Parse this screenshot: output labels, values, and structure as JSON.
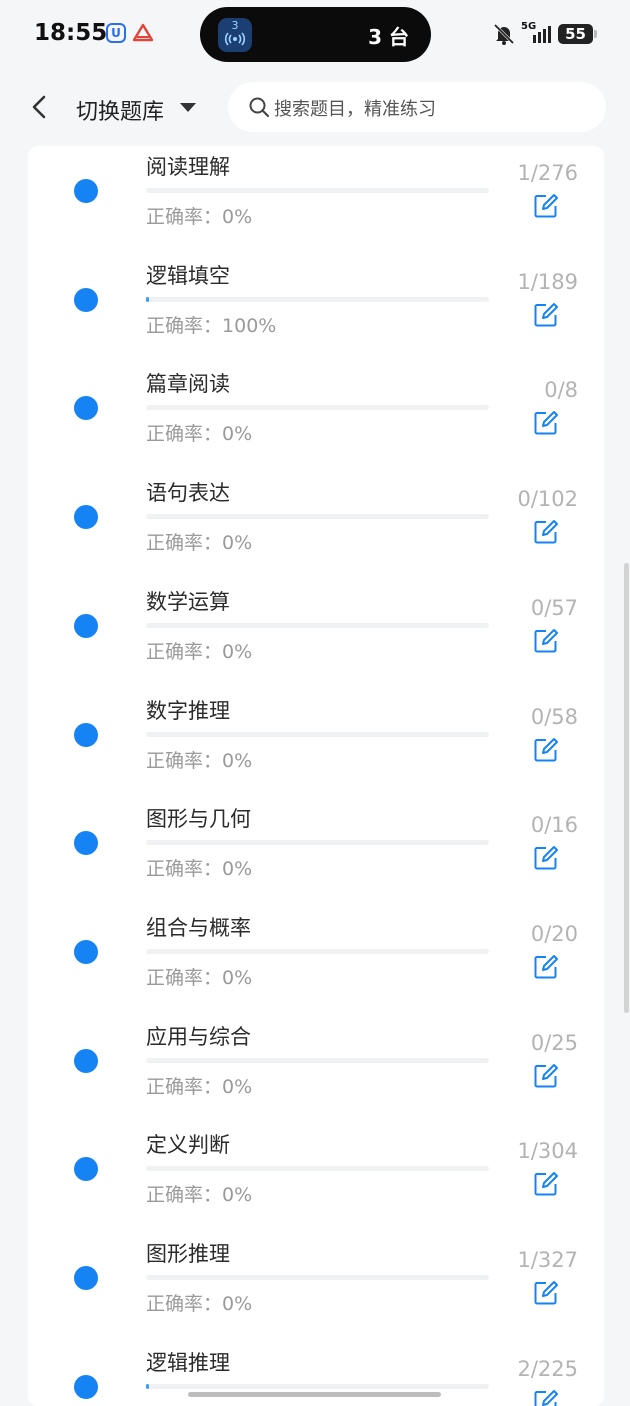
{
  "status_bar": {
    "time": "18:55",
    "island_text": "3 台",
    "island_badge": "3",
    "network": "5G",
    "battery": "55"
  },
  "header": {
    "title": "切换题库",
    "search_placeholder": "搜索题目，精准练习"
  },
  "colors": {
    "accent": "#1683f4",
    "progress": "#3aa0f5"
  },
  "list": {
    "accuracy_label": "正确率：",
    "items": [
      {
        "title": "阅读理解",
        "accuracy": "0%",
        "count": "1/276",
        "progress": 0.0
      },
      {
        "title": "逻辑填空",
        "accuracy": "100%",
        "count": "1/189",
        "progress": 0.005
      },
      {
        "title": "篇章阅读",
        "accuracy": "0%",
        "count": "0/8",
        "progress": 0.0
      },
      {
        "title": "语句表达",
        "accuracy": "0%",
        "count": "0/102",
        "progress": 0.0
      },
      {
        "title": "数学运算",
        "accuracy": "0%",
        "count": "0/57",
        "progress": 0.0
      },
      {
        "title": "数字推理",
        "accuracy": "0%",
        "count": "0/58",
        "progress": 0.0
      },
      {
        "title": "图形与几何",
        "accuracy": "0%",
        "count": "0/16",
        "progress": 0.0
      },
      {
        "title": "组合与概率",
        "accuracy": "0%",
        "count": "0/20",
        "progress": 0.0
      },
      {
        "title": "应用与综合",
        "accuracy": "0%",
        "count": "0/25",
        "progress": 0.0
      },
      {
        "title": "定义判断",
        "accuracy": "0%",
        "count": "1/304",
        "progress": 0.0
      },
      {
        "title": "图形推理",
        "accuracy": "0%",
        "count": "1/327",
        "progress": 0.0
      },
      {
        "title": "逻辑推理",
        "accuracy": "",
        "count": "2/225",
        "progress": 0.005
      }
    ]
  }
}
